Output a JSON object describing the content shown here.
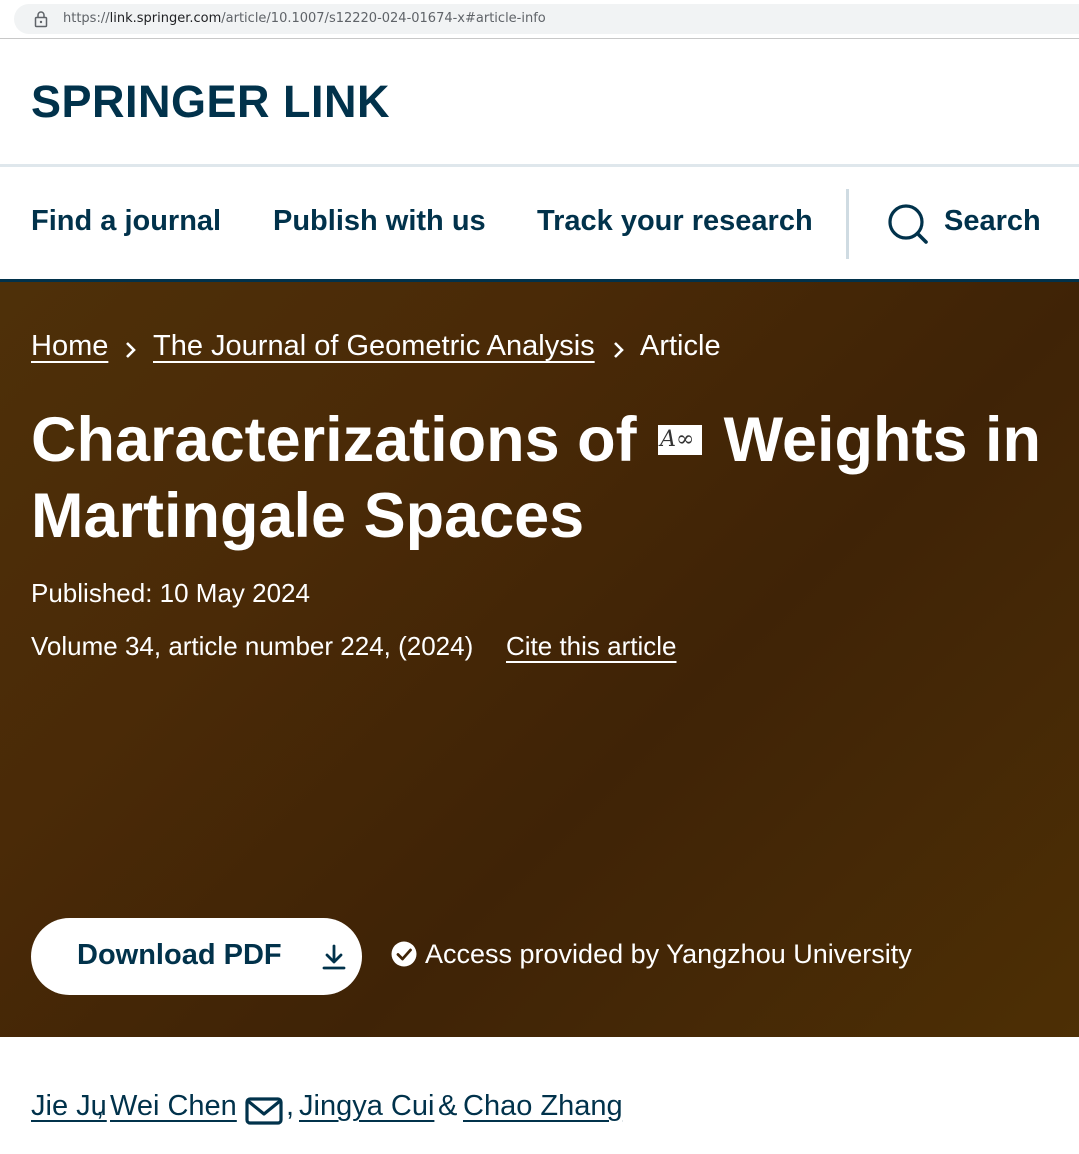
{
  "browser": {
    "url_prefix": "https://",
    "url_host": "link.springer.com",
    "url_path": "/article/10.1007/s12220-024-01674-x#article-info"
  },
  "brand": {
    "logo_text": "SPRINGER LINK",
    "color": "#01324b"
  },
  "nav": {
    "items": [
      {
        "label": "Find a journal"
      },
      {
        "label": "Publish with us"
      },
      {
        "label": "Track your research"
      }
    ],
    "search_label": "Search",
    "search_icon": "search-icon"
  },
  "breadcrumb": {
    "items": [
      {
        "label": "Home"
      },
      {
        "label": "The Journal of Geometric Analysis"
      },
      {
        "label": "Article"
      }
    ]
  },
  "article": {
    "title_part1": "Characterizations of",
    "title_math": "A∞",
    "title_part2": "Weights in Martingale Spaces",
    "published": "Published: 10 May 2024",
    "volume": "Volume 34, article number 224, (2024)",
    "cite_label": "Cite this article"
  },
  "actions": {
    "download_pdf": "Download PDF",
    "download_icon": "download-icon",
    "access_text": "Access provided by Yangzhou University",
    "access_icon": "check-circle-icon"
  },
  "authors": {
    "names": [
      "Jie Ju",
      "Wei Chen",
      "Jingya Cui",
      "Chao Zhang"
    ],
    "comma": ",",
    "ampersand": "&",
    "mail_icon": "envelope-icon"
  },
  "colors": {
    "hero_bg": "#4a2a07",
    "text_dark": "#01324b"
  }
}
